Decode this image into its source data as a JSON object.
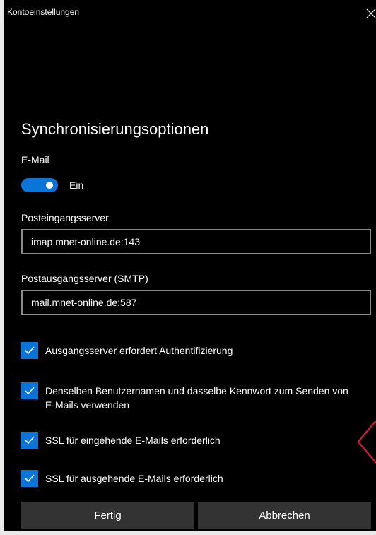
{
  "window": {
    "title": "Kontoeinstellungen",
    "close_icon": "close-icon"
  },
  "section": {
    "title": "Synchronisierungsoptionen"
  },
  "email": {
    "label": "E-Mail",
    "toggle_state": "Ein",
    "toggle_on": true,
    "accent": "#0a74d8"
  },
  "incoming": {
    "label": "Posteingangsserver",
    "value": "imap.mnet-online.de:143"
  },
  "outgoing": {
    "label": "Postausgangsserver (SMTP)",
    "value": "mail.mnet-online.de:587"
  },
  "checkboxes": [
    {
      "label": "Ausgangsserver erfordert Authentifizierung",
      "checked": true
    },
    {
      "label": "Denselben Benutzernamen und dasselbe Kennwort zum Senden von E-Mails verwenden",
      "checked": true
    },
    {
      "label": "SSL für eingehende E-Mails erforderlich",
      "checked": true
    },
    {
      "label": "SSL für ausgehende E-Mails erforderlich",
      "checked": true
    }
  ],
  "buttons": {
    "done": "Fertig",
    "cancel": "Abbrechen"
  },
  "colors": {
    "background": "#000000",
    "button_bg": "#333333",
    "input_border": "#8a8a8a",
    "chevron": "#c4202b"
  }
}
